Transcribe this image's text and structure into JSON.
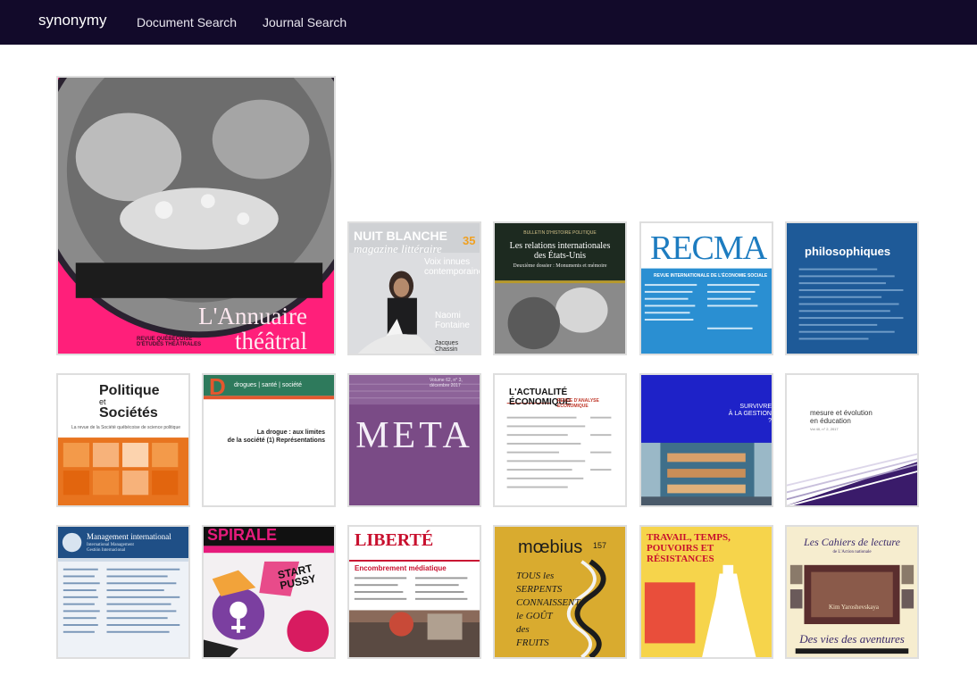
{
  "nav": {
    "brand": "synonymy",
    "links": [
      "Document Search",
      "Journal Search"
    ]
  },
  "covers": {
    "annuaire": {
      "line1": "L'Annuaire",
      "line2": "théâtral",
      "sub": "REVUE QUÉBÉCOISE D'ÉTUDES THÉÂTRALES"
    },
    "nuit": {
      "title": "NUIT BLANCHE",
      "sub": "magazine littéraire",
      "number": "35",
      "feature1": "Voix innues",
      "feature2": "contemporaines",
      "name1": "Naomi",
      "name2": "Fontaine",
      "name3": "Jacques Chassin"
    },
    "bulletin": {
      "kicker": "BULLETIN D'HISTOIRE POLITIQUE",
      "title1": "Les relations internationales",
      "title2": "des États-Unis",
      "sub": "Deuxième dossier : Monuments et mémoire"
    },
    "recma": {
      "title": "RECMA",
      "sub": "REVUE INTERNATIONALE DE L'ÉCONOMIE SOCIALE"
    },
    "philo": {
      "title": "philosophiques"
    },
    "politique": {
      "line1": "Politique",
      "et": "et",
      "line2": "Sociétés",
      "sub": "La revue de la Société québécoise de science politique"
    },
    "drogues": {
      "logo": "D",
      "header": "drogues | santé | société",
      "title1": "La drogue : aux limites",
      "title2": "de la société (1) Représentations"
    },
    "meta": {
      "title": "META",
      "sub": "Volume 62, n° 3, décembre 2017"
    },
    "actualite": {
      "title": "L'ACTUALITÉ ÉCONOMIQUE",
      "sub": "REVUE D'ANALYSE ÉCONOMIQUE"
    },
    "survivre": {
      "line1": "SURVIVRE",
      "line2": "À LA GESTION ?"
    },
    "mesure": {
      "line1": "mesure et évolution",
      "line2": "en éducation",
      "vol": "Vol 40, n° 2, 2017"
    },
    "mgmt": {
      "title": "Management international",
      "sub1": "International Management",
      "sub2": "Gestión Internacional"
    },
    "spirale": {
      "title": "SPIRALE",
      "tag1": "START",
      "tag2": "PUSSY"
    },
    "liberte": {
      "title": "LIBERTÉ",
      "theme": "Encombrement médiatique"
    },
    "moebius": {
      "title": "mœbius",
      "number": "157",
      "text": [
        "TOUS les",
        "SERPENTS",
        "CONNAISSENT",
        "le GOÛT",
        "des",
        "FRUITS"
      ]
    },
    "travail": {
      "title": [
        "TRAVAIL, TEMPS,",
        "POUVOIRS ET",
        "RÉSISTANCES"
      ]
    },
    "cahiers": {
      "top": "Les Cahiers de lecture",
      "sub": "de L'Action nationale",
      "author": "Kim Yaroshevskaya",
      "bottom": "Des vies des aventures"
    }
  },
  "colors": {
    "navbar": "#120a2a",
    "annuaire_pink": "#ff1f7a",
    "recma_blue": "#2a8fd2",
    "philo_blue": "#1e5a98",
    "drogues_green": "#2e7a5c",
    "meta_purple": "#7a4b86",
    "survivre_blue": "#1e22c8",
    "mesure_purple": "#3a1b6a",
    "moebius_gold": "#d9ab2f",
    "travail_yellow": "#f6d44b",
    "cahiers_cream": "#f6edcf"
  }
}
